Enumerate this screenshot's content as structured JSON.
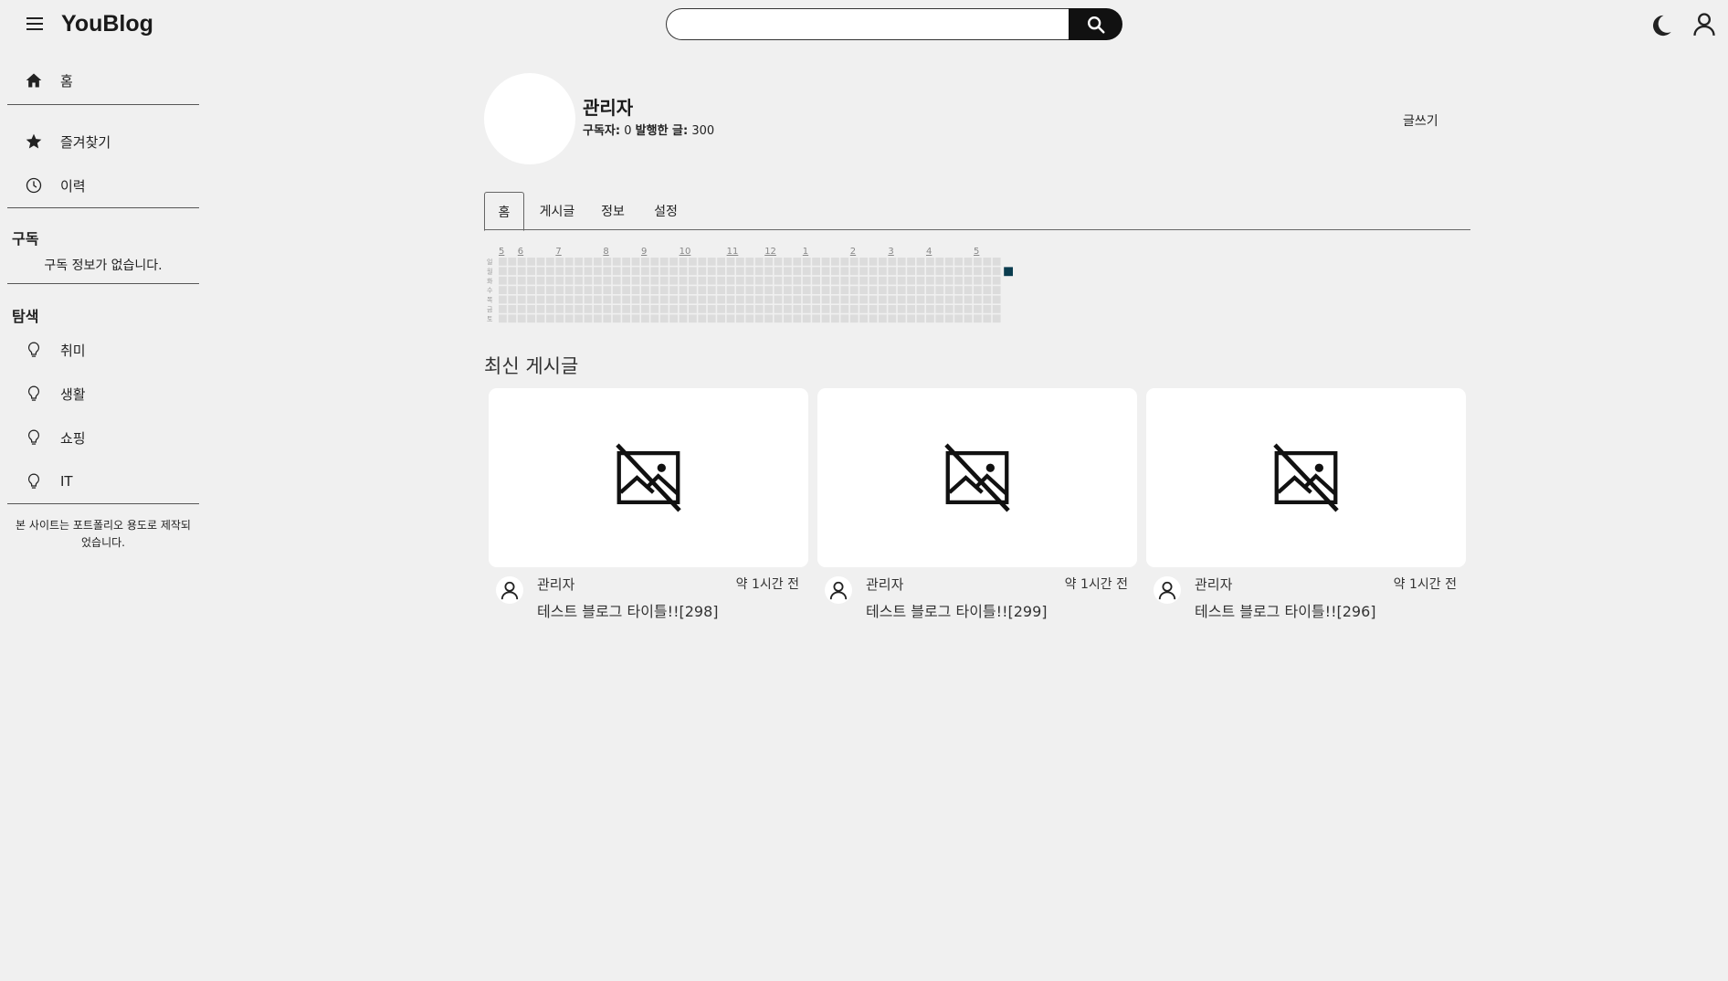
{
  "header": {
    "logo": "YouBlog",
    "search_placeholder": "",
    "search_value": ""
  },
  "sidebar": {
    "nav": [
      {
        "label": "홈",
        "icon": "home-icon"
      },
      {
        "label": "즐겨찾기",
        "icon": "star-icon"
      },
      {
        "label": "이력",
        "icon": "clock-icon"
      }
    ],
    "subscribe_heading": "구독",
    "subscribe_empty": "구독 정보가 없습니다.",
    "explore_heading": "탐색",
    "explore": [
      {
        "label": "취미",
        "icon": "lightbulb-icon"
      },
      {
        "label": "생활",
        "icon": "lightbulb-icon"
      },
      {
        "label": "쇼핑",
        "icon": "lightbulb-icon"
      },
      {
        "label": "IT",
        "icon": "lightbulb-icon"
      }
    ],
    "footer": "본 사이트는 포트폴리오 용도로 제작되었습니다."
  },
  "profile": {
    "name": "관리자",
    "subscribers_label": "구독자:",
    "subscribers": "0",
    "posts_label": "발행한 글:",
    "posts": "300",
    "write_label": "글쓰기"
  },
  "tabs": [
    {
      "label": "홈",
      "active": true
    },
    {
      "label": "게시글",
      "active": false
    },
    {
      "label": "정보",
      "active": false
    },
    {
      "label": "설정",
      "active": false
    }
  ],
  "activity": {
    "day_labels": [
      "일",
      "월",
      "화",
      "수",
      "목",
      "금",
      "토"
    ],
    "month_labels": [
      {
        "label": "5",
        "week": 0
      },
      {
        "label": "6",
        "week": 2
      },
      {
        "label": "7",
        "week": 6
      },
      {
        "label": "8",
        "week": 11
      },
      {
        "label": "9",
        "week": 15
      },
      {
        "label": "10",
        "week": 19
      },
      {
        "label": "11",
        "week": 24
      },
      {
        "label": "12",
        "week": 28
      },
      {
        "label": "1",
        "week": 32
      },
      {
        "label": "2",
        "week": 37
      },
      {
        "label": "3",
        "week": 41
      },
      {
        "label": "4",
        "week": 45
      },
      {
        "label": "5",
        "week": 50
      }
    ],
    "weeks": 53,
    "active_cell": {
      "week": 53,
      "day": 1
    },
    "empty_color": "#dcdcdc",
    "active_color": "#0b3d4f"
  },
  "latest": {
    "title": "최신 게시글",
    "posts": [
      {
        "author": "관리자",
        "time": "약 1시간 전",
        "title": "테스트 블로그 타이틀!![298]"
      },
      {
        "author": "관리자",
        "time": "약 1시간 전",
        "title": "테스트 블로그 타이틀!![299]"
      },
      {
        "author": "관리자",
        "time": "약 1시간 전",
        "title": "테스트 블로그 타이틀!![296]"
      }
    ]
  }
}
